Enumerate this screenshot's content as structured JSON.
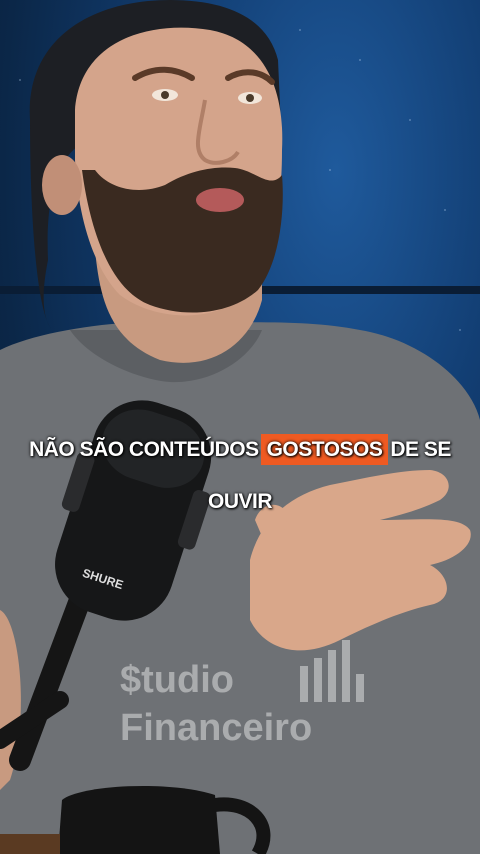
{
  "caption": {
    "line1_before": "NÃO SÃO CONTEÚDOS",
    "line1_highlight": "GOSTOSOS",
    "line1_after": "DE SE",
    "line2": "OUVIR",
    "highlight_color": "#ef5a22"
  },
  "watermark": {
    "line1": "$tudio",
    "line2": "Financeiro"
  },
  "microphone_brand": "SHURE"
}
